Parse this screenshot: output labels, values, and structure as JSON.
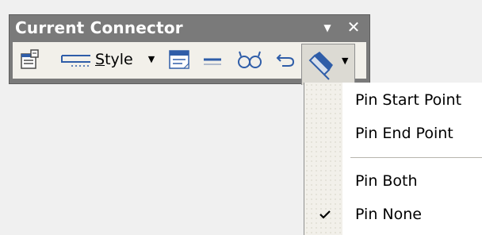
{
  "window": {
    "title": "Current Connector",
    "dropdown_icon": "triangle-down-icon",
    "close_icon": "close-icon"
  },
  "toolbar": {
    "style_label_prefix": "S",
    "style_label_rest": "tyle",
    "icons": [
      "properties-icon",
      "connector-style-icon",
      "dropdown-arrow-icon",
      "note-icon",
      "line-icon",
      "link-icon",
      "undo-icon",
      "pin-icon",
      "dropdown-arrow-icon"
    ]
  },
  "menu": {
    "items": [
      {
        "label": "Pin Start Point",
        "checked": false
      },
      {
        "label": "Pin End Point",
        "checked": false
      },
      {
        "label": "Pin Both",
        "checked": false
      },
      {
        "label": "Pin None",
        "checked": true
      }
    ]
  },
  "colors": {
    "titlebar": "#7a7a7a",
    "toolbar_bg": "#f2f0ea",
    "menu_bg": "#ffffff",
    "accent_blue": "#2f5da8"
  }
}
